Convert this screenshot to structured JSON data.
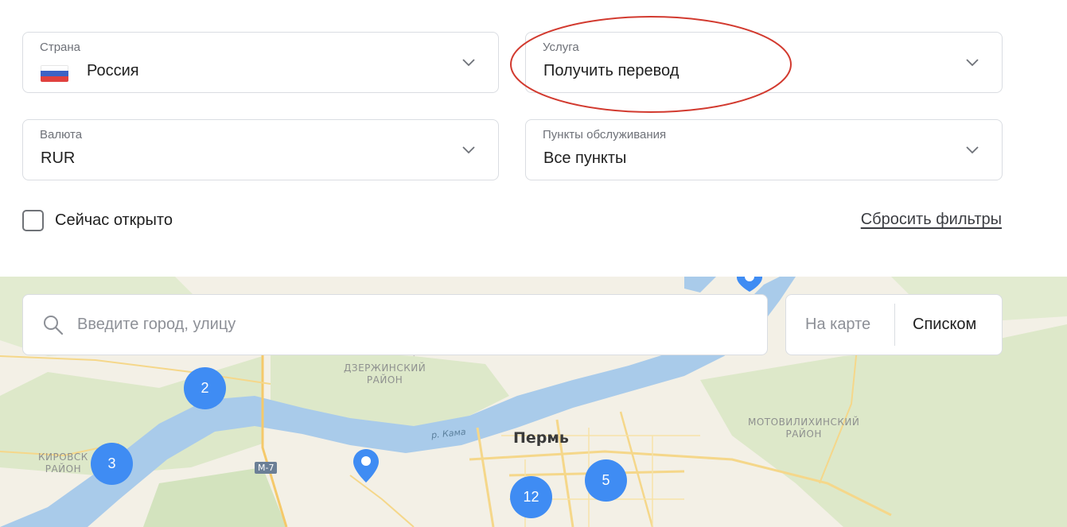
{
  "filters": {
    "country": {
      "label": "Страна",
      "value": "Россия"
    },
    "service": {
      "label": "Услуга",
      "value": "Получить перевод"
    },
    "currency": {
      "label": "Валюта",
      "value": "RUR"
    },
    "service_points": {
      "label": "Пункты обслуживания",
      "value": "Все пункты"
    }
  },
  "open_now": {
    "label": "Сейчас открыто"
  },
  "reset": {
    "label": "Сбросить фильтры"
  },
  "search": {
    "placeholder": "Введите город, улицу"
  },
  "view_toggle": {
    "map": "На карте",
    "list": "Списком"
  },
  "map": {
    "city": "Пермь",
    "districts": {
      "dzerzhinsky": "ДЗЕРЖИНСКИЙ\nРАЙОН",
      "motovilikhinsky": "МОТОВИЛИХИНСКИЙ\nРАЙОН",
      "kirovsky": "КИРОВСК\nРАЙОН"
    },
    "river": "р. Кама",
    "highway": "М-7",
    "clusters": [
      {
        "count": "2"
      },
      {
        "count": "3"
      },
      {
        "count": "12"
      },
      {
        "count": "5"
      }
    ]
  },
  "colors": {
    "accent": "#3f8cf3",
    "annotation": "#d23a2f",
    "border": "#dadde2",
    "water": "#a9cbea"
  }
}
